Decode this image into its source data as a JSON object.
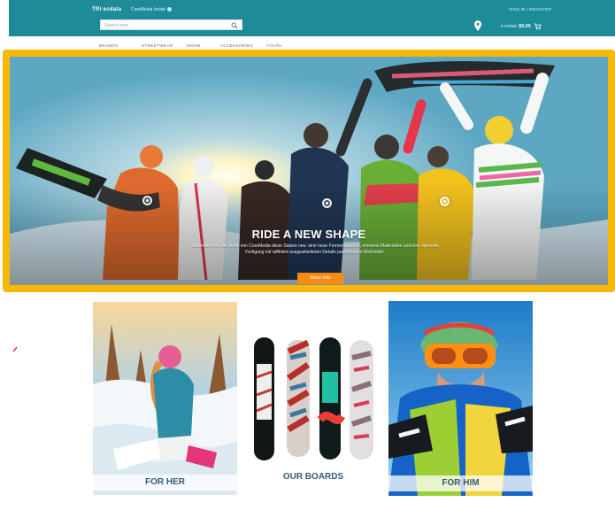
{
  "header": {
    "logo_text": "TRI   ecdata",
    "tagline": "CoreMedia Inside",
    "search": {
      "placeholder": "Search term"
    },
    "login_link": "SIGN IN / REGISTER",
    "cart": {
      "items_label": "0 ITEMS",
      "total": "$0.00"
    },
    "colors": {
      "header": "#1d8c98",
      "accent": "#f7b905",
      "button": "#f58b12"
    }
  },
  "navigation": {
    "items": [
      {
        "label": "BRANDS"
      },
      {
        "label": "STREETWEAR"
      },
      {
        "label": "SNOW"
      },
      {
        "label": "ACCESSORIES"
      },
      {
        "label": "YOUTH"
      }
    ]
  },
  "hero": {
    "title": "RIDE A NEW SHAPE",
    "description": "Entdecken Sie die Mode von CoreMedia diese Saison neu: eine neue Formensprache, erlesene Materialien und eine spezielle Fertigung mit raffiniert ausgearbeiteten Details passen neue Maßstäbe.",
    "button_label": "More Info"
  },
  "categories": [
    {
      "label": "FOR HER",
      "icon": "female-snowboarder-photo"
    },
    {
      "label": "OUR BOARDS",
      "icon": "snowboards-photo"
    },
    {
      "label": "FOR HIM",
      "icon": "male-snowboarder-photo"
    }
  ]
}
